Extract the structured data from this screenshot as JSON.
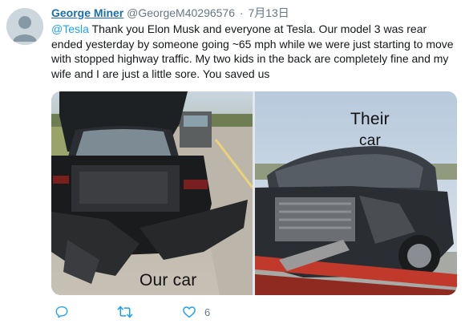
{
  "user": {
    "display_name": "George Miner",
    "handle": "@GeorgeM40296576",
    "separator": "·",
    "date": "7月13日"
  },
  "tweet": {
    "mention": "@Tesla",
    "text": " Thank you Elon Musk and everyone at Tesla. Our model 3 was rear ended yesterday by someone going ~65 mph while we were just starting to move with stopped highway traffic. My two kids in the back are completely fine and my wife and I are just a little sore. You saved us"
  },
  "media": {
    "left_caption": "Our car",
    "right_caption_line1": "Their",
    "right_caption_line2": "car"
  },
  "actions": {
    "reply_icon": "reply-icon",
    "retweet_icon": "retweet-icon",
    "like_icon": "heart-icon",
    "like_count": "6"
  },
  "colors": {
    "name_link": "#1b6ea8",
    "mention": "#1da1f2",
    "secondary_text": "#657786",
    "icon_blue": "#1da1f2",
    "icon_gray": "#657786"
  }
}
